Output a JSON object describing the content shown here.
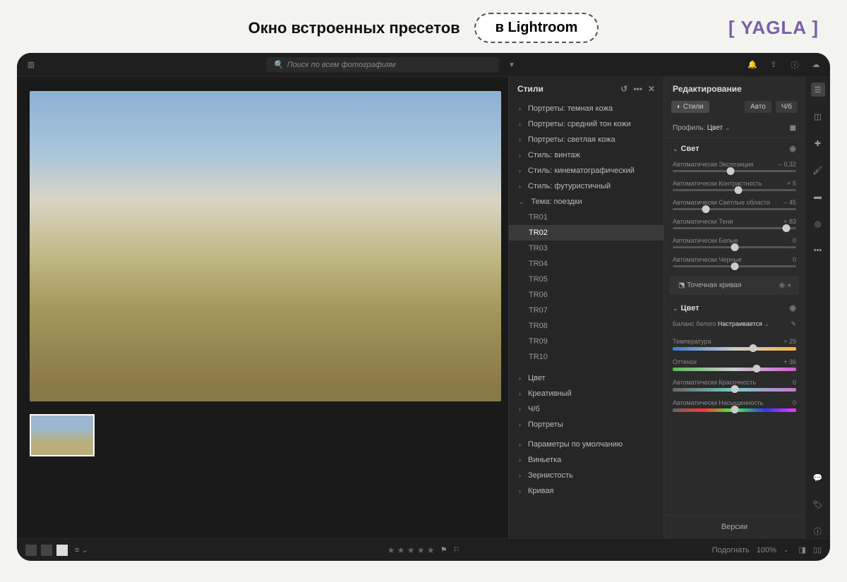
{
  "outer": {
    "title": "Окно встроенных пресетов",
    "chip": "в Lightroom",
    "brand": "[ YAGLA ]"
  },
  "topbar": {
    "search_placeholder": "Поиск по всем фотографиям"
  },
  "presets": {
    "title": "Стили",
    "groups_top": [
      "Портреты: темная кожа",
      "Портреты: средний тон кожи",
      "Портреты: светлая кожа",
      "Стиль: винтаж",
      "Стиль: кинематографический",
      "Стиль: футуристичный"
    ],
    "expanded_group": "Тема: поездки",
    "items": [
      "TR01",
      "TR02",
      "TR03",
      "TR04",
      "TR05",
      "TR06",
      "TR07",
      "TR08",
      "TR09",
      "TR10"
    ],
    "selected": "TR02",
    "groups_bottom": [
      "Цвет",
      "Креативный",
      "Ч/б",
      "Портреты"
    ],
    "defaults": "Параметры по умолчанию",
    "groups_bottom2": [
      "Виньетка",
      "Зернистость",
      "Кривая"
    ]
  },
  "edit": {
    "title": "Редактирование",
    "btn_styles": "Стили",
    "btn_auto": "Авто",
    "btn_bw": "Ч/б",
    "profile_label": "Профиль:",
    "profile_value": "Цвет",
    "light_section": "Свет",
    "sliders": [
      {
        "label": "Автоматически Экспозиция",
        "value": "– 0,32",
        "pos": 47
      },
      {
        "label": "Автоматически Контрастность",
        "value": "+ 5",
        "pos": 53
      },
      {
        "label": "Автоматически Светлые области",
        "value": "– 45",
        "pos": 27
      },
      {
        "label": "Автоматически Тени",
        "value": "+ 83",
        "pos": 92
      },
      {
        "label": "Автоматически Белые",
        "value": "0",
        "pos": 50
      },
      {
        "label": "Автоматически Черные",
        "value": "0",
        "pos": 50
      }
    ],
    "curve": "Точечная кривая",
    "color_section": "Цвет",
    "wb_label": "Баланс белого",
    "wb_value": "Настраивается",
    "color_sliders": [
      {
        "label": "Температура",
        "value": "+ 29",
        "pos": 65,
        "gradient": "linear-gradient(to right,#3a7bd5,#ccc,#ffb347)"
      },
      {
        "label": "Оттенок",
        "value": "+ 36",
        "pos": 68,
        "gradient": "linear-gradient(to right,#5cb85c,#ccc,#d65ad6)"
      },
      {
        "label": "Автоматически Красочность",
        "value": "0",
        "pos": 50,
        "gradient": "linear-gradient(to right,#666,#7cc,#c7c)"
      },
      {
        "label": "Автоматически Насыщенность",
        "value": "0",
        "pos": 50,
        "gradient": "linear-gradient(to right,#666,#f33,#3f3,#33f,#f3f)"
      }
    ],
    "versions": "Версии"
  },
  "bottombar": {
    "fit": "Подогнать",
    "zoom": "100%"
  }
}
